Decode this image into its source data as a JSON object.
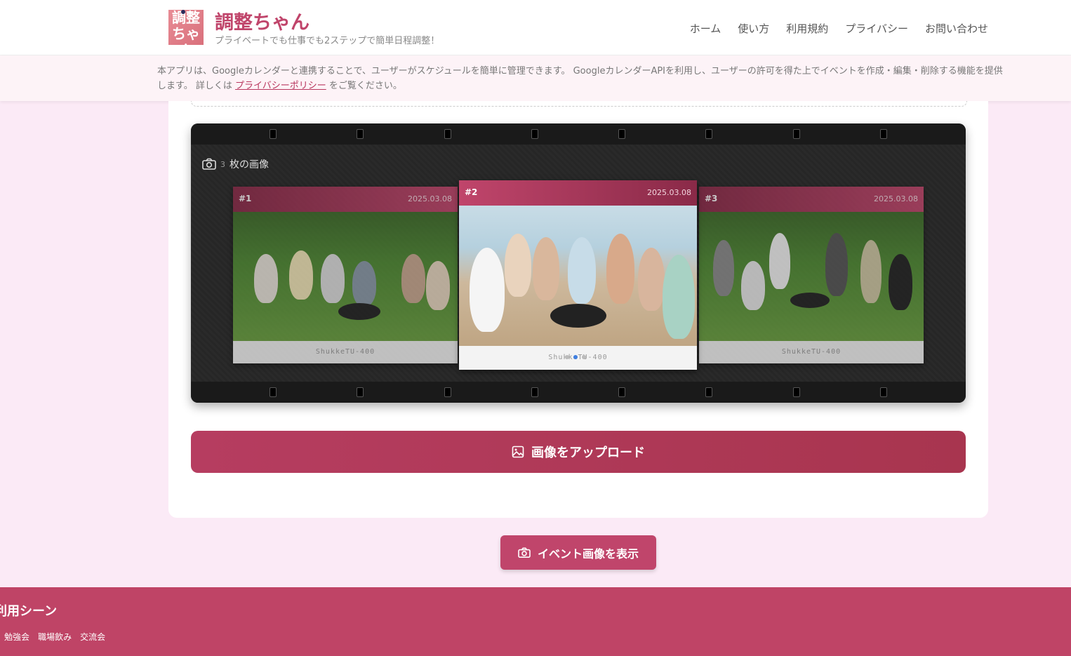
{
  "header": {
    "logo_text_top": "調整",
    "logo_text_bottom": "ちゃん",
    "title": "調整ちゃん",
    "tagline": "プライベートでも仕事でも2ステップで簡単日程調整！",
    "nav": [
      "ホーム",
      "使い方",
      "利用規約",
      "プライバシー",
      "お問い合わせ"
    ]
  },
  "notice": {
    "text_before": "本アプリは、Googleカレンダーと連携することで、ユーザーがスケジュールを簡単に管理できます。 GoogleカレンダーAPIを利用し、ユーザーの許可を得た上でイベントを作成・編集・削除する機能を提供します。 詳しくは ",
    "link": "プライバシーポリシー",
    "text_after": " をご覧ください。"
  },
  "gallery": {
    "count_num": "3",
    "count_label": "枚の画像",
    "photos": [
      {
        "num": "#1",
        "date": "2025.03.08",
        "caption": "ShukkeTU-400"
      },
      {
        "num": "#2",
        "date": "2025.03.08",
        "caption": "ShukkeTU-400"
      },
      {
        "num": "#3",
        "date": "2025.03.08",
        "caption": "ShukkeTU-400"
      }
    ],
    "active_index": 2,
    "total": 3
  },
  "buttons": {
    "upload": "画像をアップロード",
    "show_event_images": "イベント画像を表示"
  },
  "footer": {
    "title": "利用シーン",
    "tags": [
      "/",
      "勉強会",
      "職場飲み",
      "交流会"
    ]
  },
  "colors": {
    "accent": "#c0456b",
    "background": "#fbeaf6",
    "footer": "#bf4466"
  }
}
